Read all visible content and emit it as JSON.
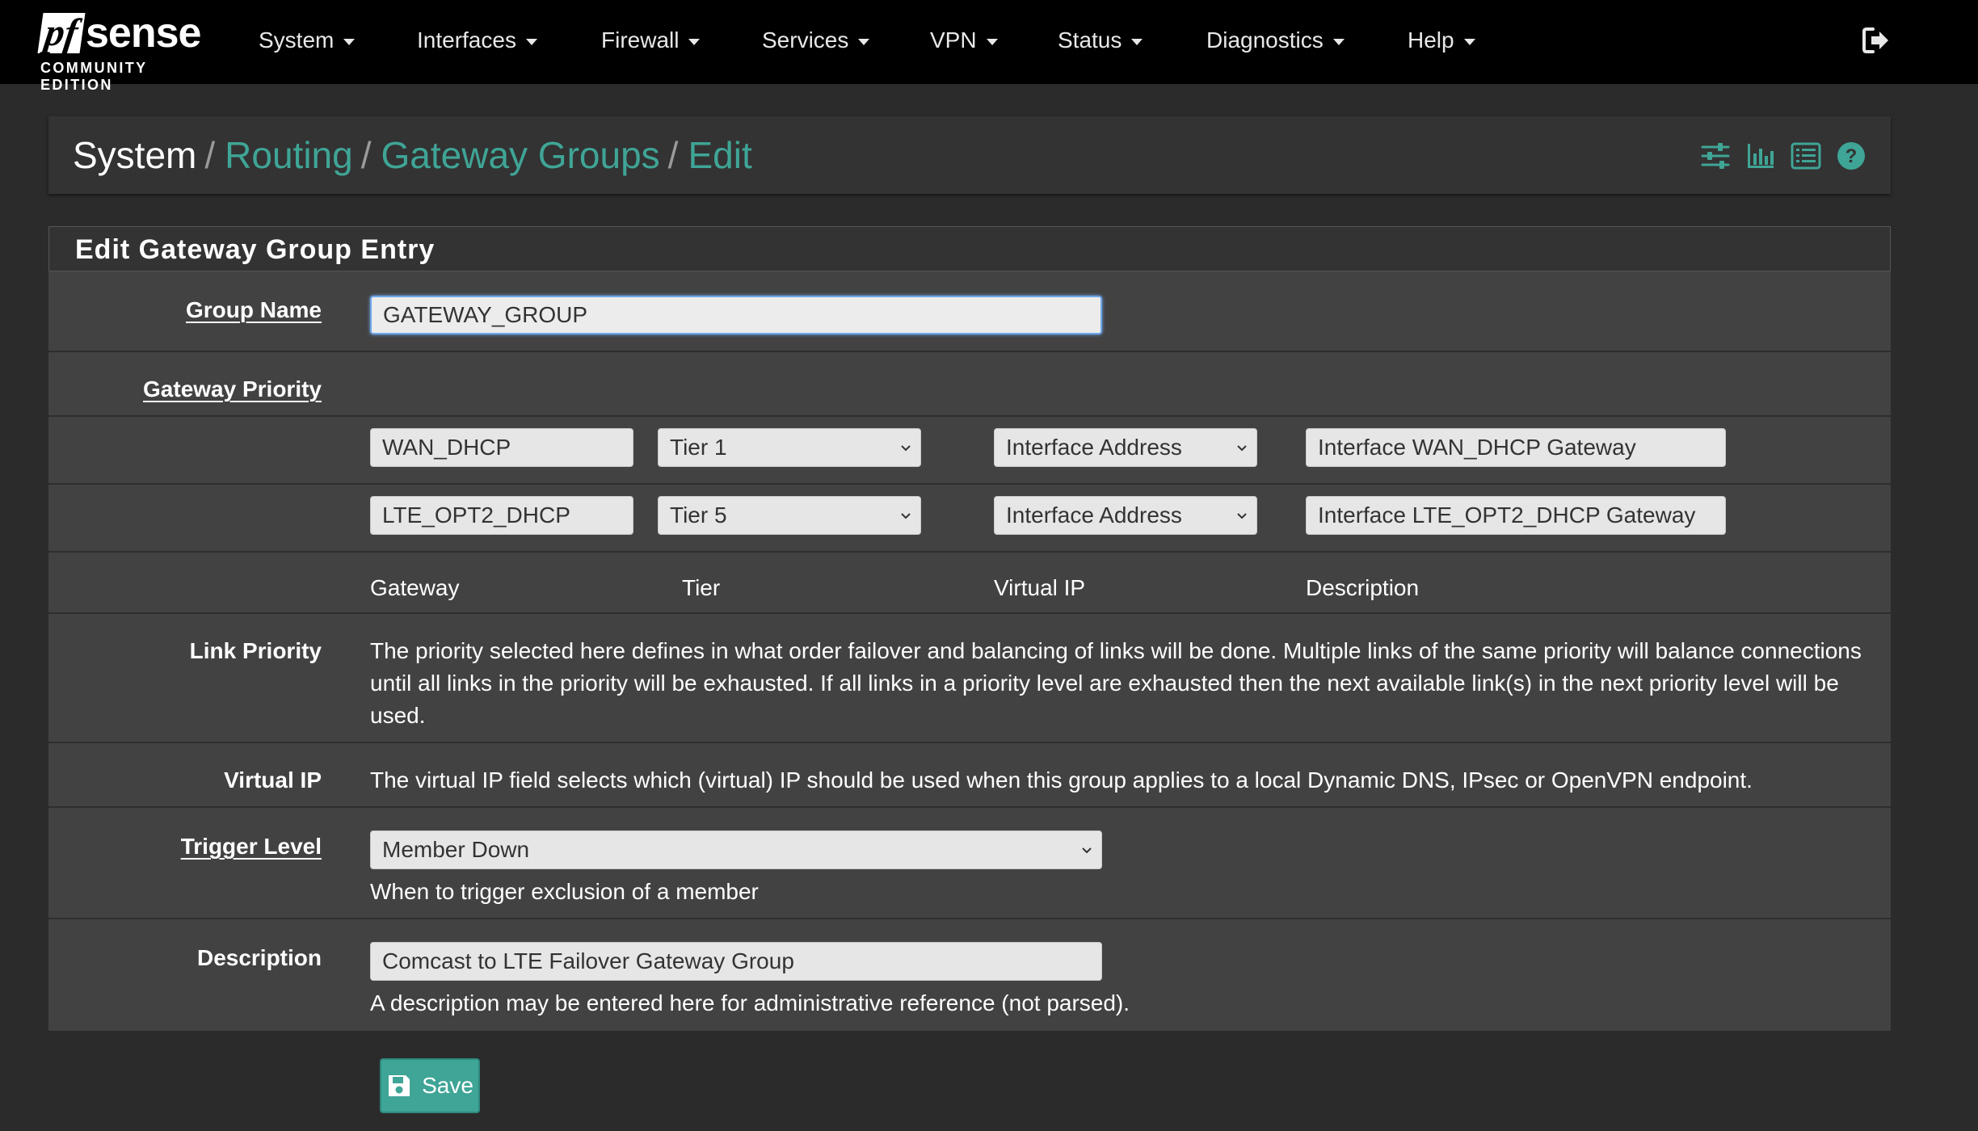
{
  "brand": {
    "logo_pf": "pf",
    "logo_sense": "sense",
    "edition": "COMMUNITY EDITION"
  },
  "nav": {
    "items": [
      {
        "label": "System"
      },
      {
        "label": "Interfaces"
      },
      {
        "label": "Firewall"
      },
      {
        "label": "Services"
      },
      {
        "label": "VPN"
      },
      {
        "label": "Status"
      },
      {
        "label": "Diagnostics"
      },
      {
        "label": "Help"
      }
    ],
    "logout_icon": "sign-out-icon"
  },
  "breadcrumb": {
    "items": [
      "System",
      "Routing",
      "Gateway Groups",
      "Edit"
    ],
    "separator": "/",
    "icons": [
      "sliders-icon",
      "bar-chart-icon",
      "list-icon",
      "help-icon"
    ]
  },
  "panel": {
    "title": "Edit Gateway Group Entry",
    "group_name": {
      "label": "Group Name",
      "value": "GATEWAY_GROUP"
    },
    "gateway_priority": {
      "label": "Gateway Priority",
      "rows": [
        {
          "gateway": "WAN_DHCP",
          "tier": "Tier 1",
          "virtual_ip": "Interface Address",
          "description": "Interface WAN_DHCP Gateway"
        },
        {
          "gateway": "LTE_OPT2_DHCP",
          "tier": "Tier 5",
          "virtual_ip": "Interface Address",
          "description": "Interface LTE_OPT2_DHCP Gateway"
        }
      ],
      "columns": [
        "Gateway",
        "Tier",
        "Virtual IP",
        "Description"
      ]
    },
    "link_priority": {
      "label": "Link Priority",
      "text": "The priority selected here defines in what order failover and balancing of links will be done. Multiple links of the same priority will balance connections until all links in the priority will be exhausted. If all links in a priority level are exhausted then the next available link(s) in the next priority level will be used."
    },
    "virtual_ip": {
      "label": "Virtual IP",
      "text": "The virtual IP field selects which (virtual) IP should be used when this group applies to a local Dynamic DNS, IPsec or OpenVPN endpoint."
    },
    "trigger_level": {
      "label": "Trigger Level",
      "value": "Member Down",
      "help": "When to trigger exclusion of a member"
    },
    "description": {
      "label": "Description",
      "value": "Comcast to LTE Failover Gateway Group",
      "help": "A description may be entered here for administrative reference (not parsed)."
    }
  },
  "save": {
    "label": "Save",
    "icon": "floppy-disk-icon"
  },
  "colors": {
    "navbar": "#000000",
    "background": "#2b2b2b",
    "panel": "#424242",
    "accent": "#3fa596",
    "input": "#e6e6e6"
  }
}
